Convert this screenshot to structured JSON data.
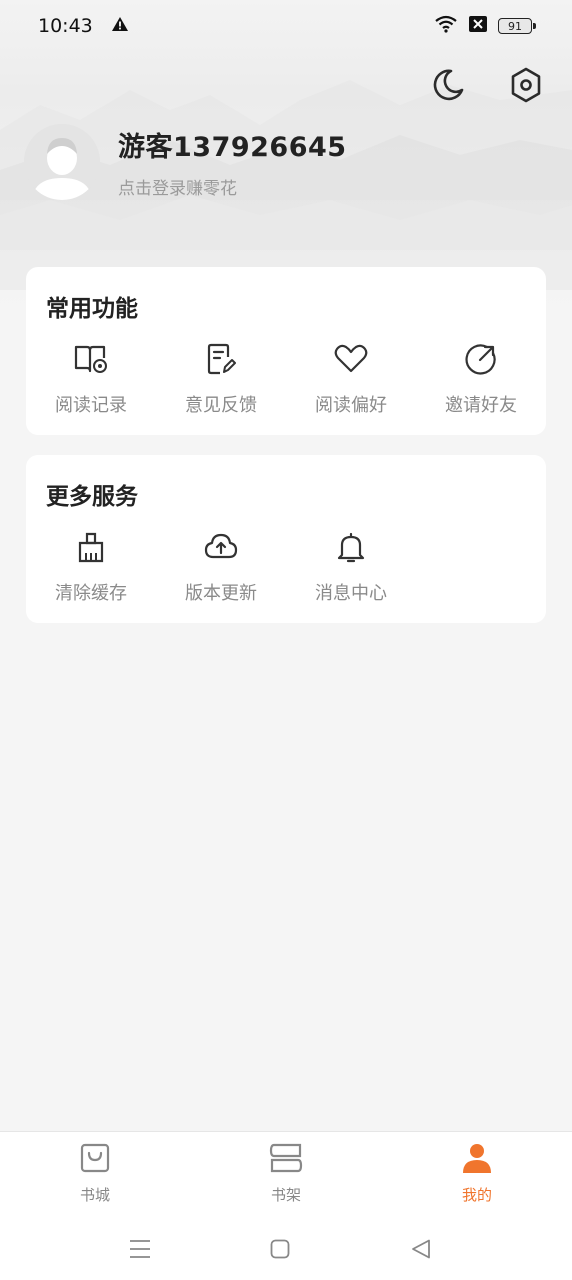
{
  "status_bar": {
    "time": "10:43",
    "battery_level": "91",
    "warning_icon": "warning-icon",
    "wifi_icon": "wifi-icon",
    "sim_icon": "no-sim-icon"
  },
  "header": {
    "night_mode_icon": "moon-icon",
    "settings_icon": "settings-icon"
  },
  "profile": {
    "username": "游客137926645",
    "login_hint": "点击登录赚零花"
  },
  "common_functions": {
    "title": "常用功能",
    "items": [
      {
        "label": "阅读记录",
        "icon": "reading-history-icon"
      },
      {
        "label": "意见反馈",
        "icon": "feedback-icon"
      },
      {
        "label": "阅读偏好",
        "icon": "heart-icon"
      },
      {
        "label": "邀请好友",
        "icon": "share-icon"
      }
    ]
  },
  "more_services": {
    "title": "更多服务",
    "items": [
      {
        "label": "清除缓存",
        "icon": "broom-icon"
      },
      {
        "label": "版本更新",
        "icon": "cloud-upload-icon"
      },
      {
        "label": "消息中心",
        "icon": "bell-icon"
      }
    ]
  },
  "bottom_nav": {
    "items": [
      {
        "label": "书城",
        "icon": "shopping-bag-icon",
        "active": false
      },
      {
        "label": "书架",
        "icon": "bookshelf-icon",
        "active": false
      },
      {
        "label": "我的",
        "icon": "user-icon",
        "active": true
      }
    ]
  },
  "colors": {
    "accent": "#f0752d",
    "background": "#f5f5f5",
    "card": "#ffffff"
  }
}
